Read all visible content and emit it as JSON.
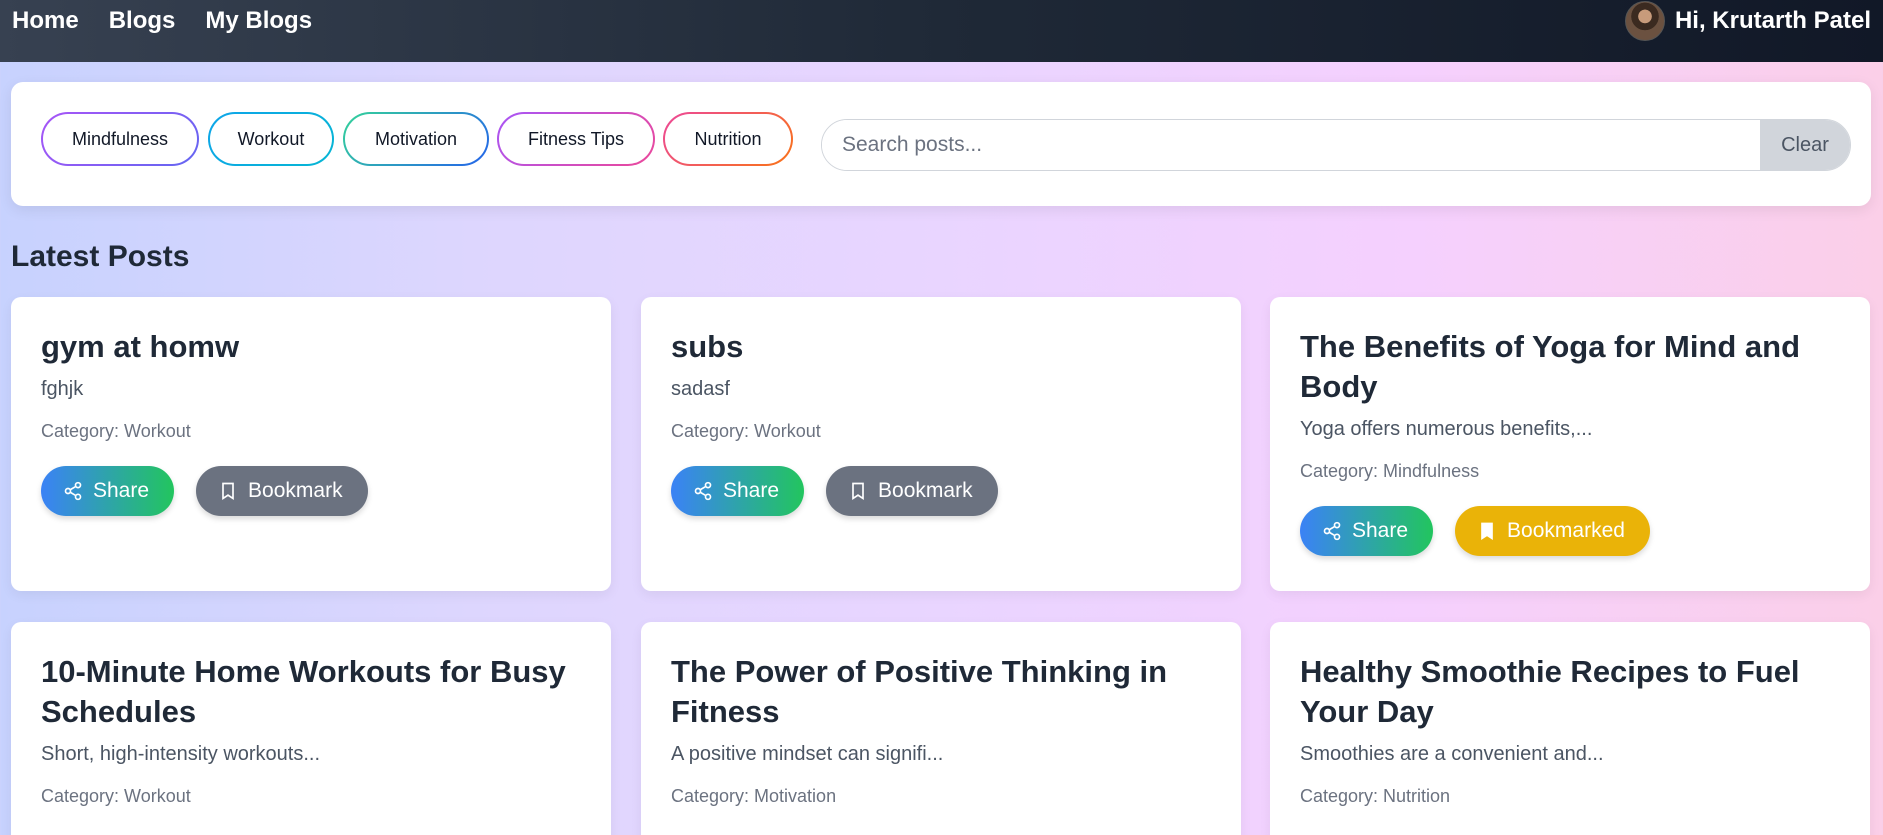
{
  "nav": {
    "links": [
      "Home",
      "Blogs",
      "My Blogs"
    ],
    "greeting": "Hi, Krutarth Patel"
  },
  "filters": {
    "chips": [
      "Mindfulness",
      "Workout",
      "Motivation",
      "Fitness Tips",
      "Nutrition"
    ],
    "search_placeholder": "Search posts...",
    "clear_label": "Clear"
  },
  "section_title": "Latest Posts",
  "posts": [
    {
      "title": "gym at homw",
      "excerpt": "fghjk",
      "category": "Category: Workout",
      "share_label": "Share",
      "bookmark_label": "Bookmark",
      "bookmarked": false
    },
    {
      "title": "subs",
      "excerpt": "sadasf",
      "category": "Category: Workout",
      "share_label": "Share",
      "bookmark_label": "Bookmark",
      "bookmarked": false
    },
    {
      "title": "The Benefits of Yoga for Mind and Body",
      "excerpt": "Yoga offers numerous benefits,...",
      "category": "Category: Mindfulness",
      "share_label": "Share",
      "bookmark_label": "Bookmarked",
      "bookmarked": true
    },
    {
      "title": "10-Minute Home Workouts for Busy Schedules",
      "excerpt": "Short, high-intensity workouts...",
      "category": "Category: Workout"
    },
    {
      "title": "The Power of Positive Thinking in Fitness",
      "excerpt": "A positive mindset can signifi...",
      "category": "Category: Motivation"
    },
    {
      "title": "Healthy Smoothie Recipes to Fuel Your Day",
      "excerpt": "Smoothies are a convenient and...",
      "category": "Category: Nutrition"
    }
  ],
  "colors": {
    "nav_bg": "#1f2937",
    "share_gradient_start": "#3b82f6",
    "share_gradient_end": "#22c55e",
    "bookmark_bg": "#6b7280",
    "bookmarked_bg": "#eab308"
  }
}
